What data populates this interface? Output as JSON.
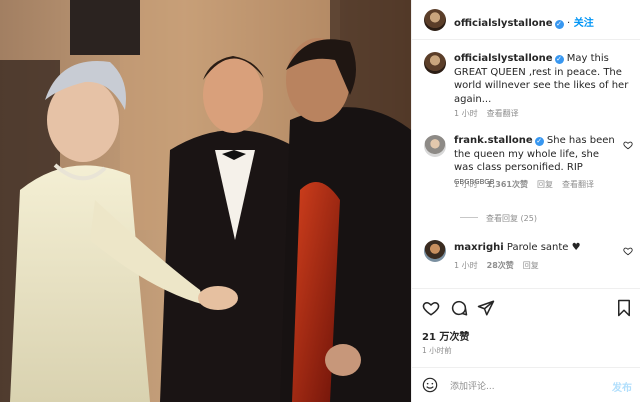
{
  "post": {
    "username": "officialslystallone",
    "follow_label": "关注"
  },
  "caption": {
    "username": "officialslystallone",
    "text": "May this GREAT QUEEN ,rest in peace. The world willnever see the likes of her again...",
    "time": "1 小时",
    "translate": "查看翻译"
  },
  "comments": [
    {
      "username": "frank.stallone",
      "text": "She has been the queen my whole life, she was class personified. RIP",
      "flags": "GBGBGBGB",
      "time": "1 小时",
      "likes": "1,361次赞",
      "reply": "回复",
      "translate": "查看翻译"
    },
    {
      "username": "maxrighi",
      "text": "Parole sante",
      "emoji": "♥",
      "time": "1 小时",
      "likes": "28次赞",
      "reply": "回复"
    }
  ],
  "view_replies": "查看回复 (25)",
  "likes_total": "21 万次赞",
  "posted_time": "1 小时前",
  "add_comment_placeholder": "添加评论...",
  "post_button": "发布",
  "icons": [
    "heart-icon",
    "comment-icon",
    "share-icon",
    "save-icon",
    "emoji-icon",
    "verified-badge"
  ]
}
